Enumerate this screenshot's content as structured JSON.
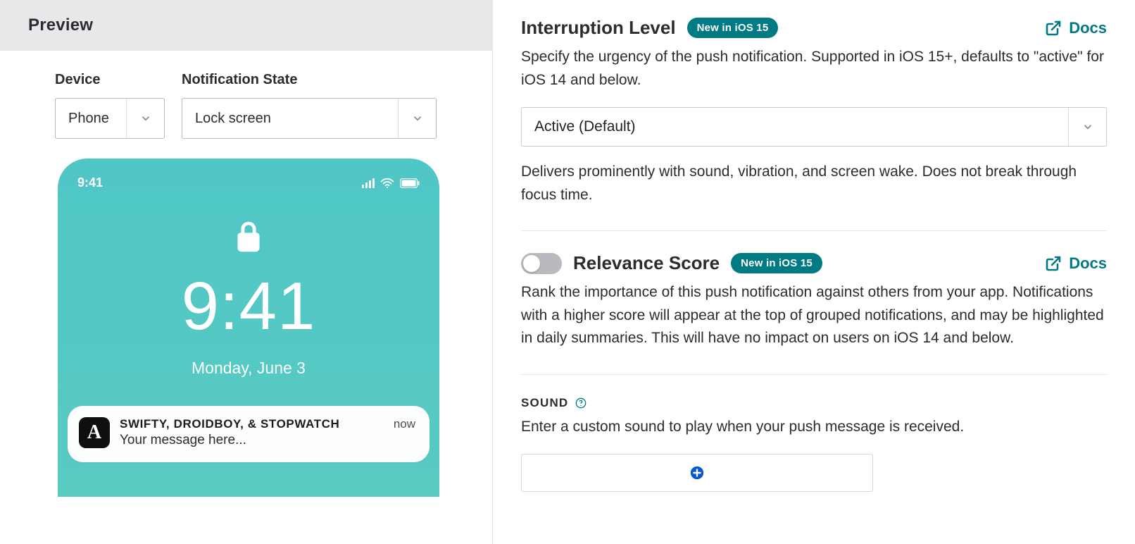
{
  "preview": {
    "header": "Preview",
    "device_label": "Device",
    "state_label": "Notification State",
    "device_value": "Phone",
    "state_value": "Lock screen",
    "phone": {
      "status_time": "9:41",
      "big_time": "9:41",
      "date": "Monday, June 3",
      "notif": {
        "app_letter": "A",
        "title": "SWIFTY, DROIDBOY, & STOPWATCH",
        "time": "now",
        "message": "Your message here..."
      }
    }
  },
  "interruption": {
    "title": "Interruption Level",
    "badge": "New in iOS 15",
    "docs": "Docs",
    "desc": "Specify the urgency of the push notification. Supported in iOS 15+, defaults to \"active\" for iOS 14 and below.",
    "select_value": "Active (Default)",
    "sub_desc": "Delivers prominently with sound, vibration, and screen wake. Does not break through focus time."
  },
  "relevance": {
    "title": "Relevance Score",
    "badge": "New in iOS 15",
    "docs": "Docs",
    "desc": "Rank the importance of this push notification against others from your app. Notifications with a higher score will appear at the top of grouped notifications, and may be highlighted in daily summaries. This will have no impact on users on iOS 14 and below."
  },
  "sound": {
    "title": "SOUND",
    "desc": "Enter a custom sound to play when your push message is received."
  }
}
